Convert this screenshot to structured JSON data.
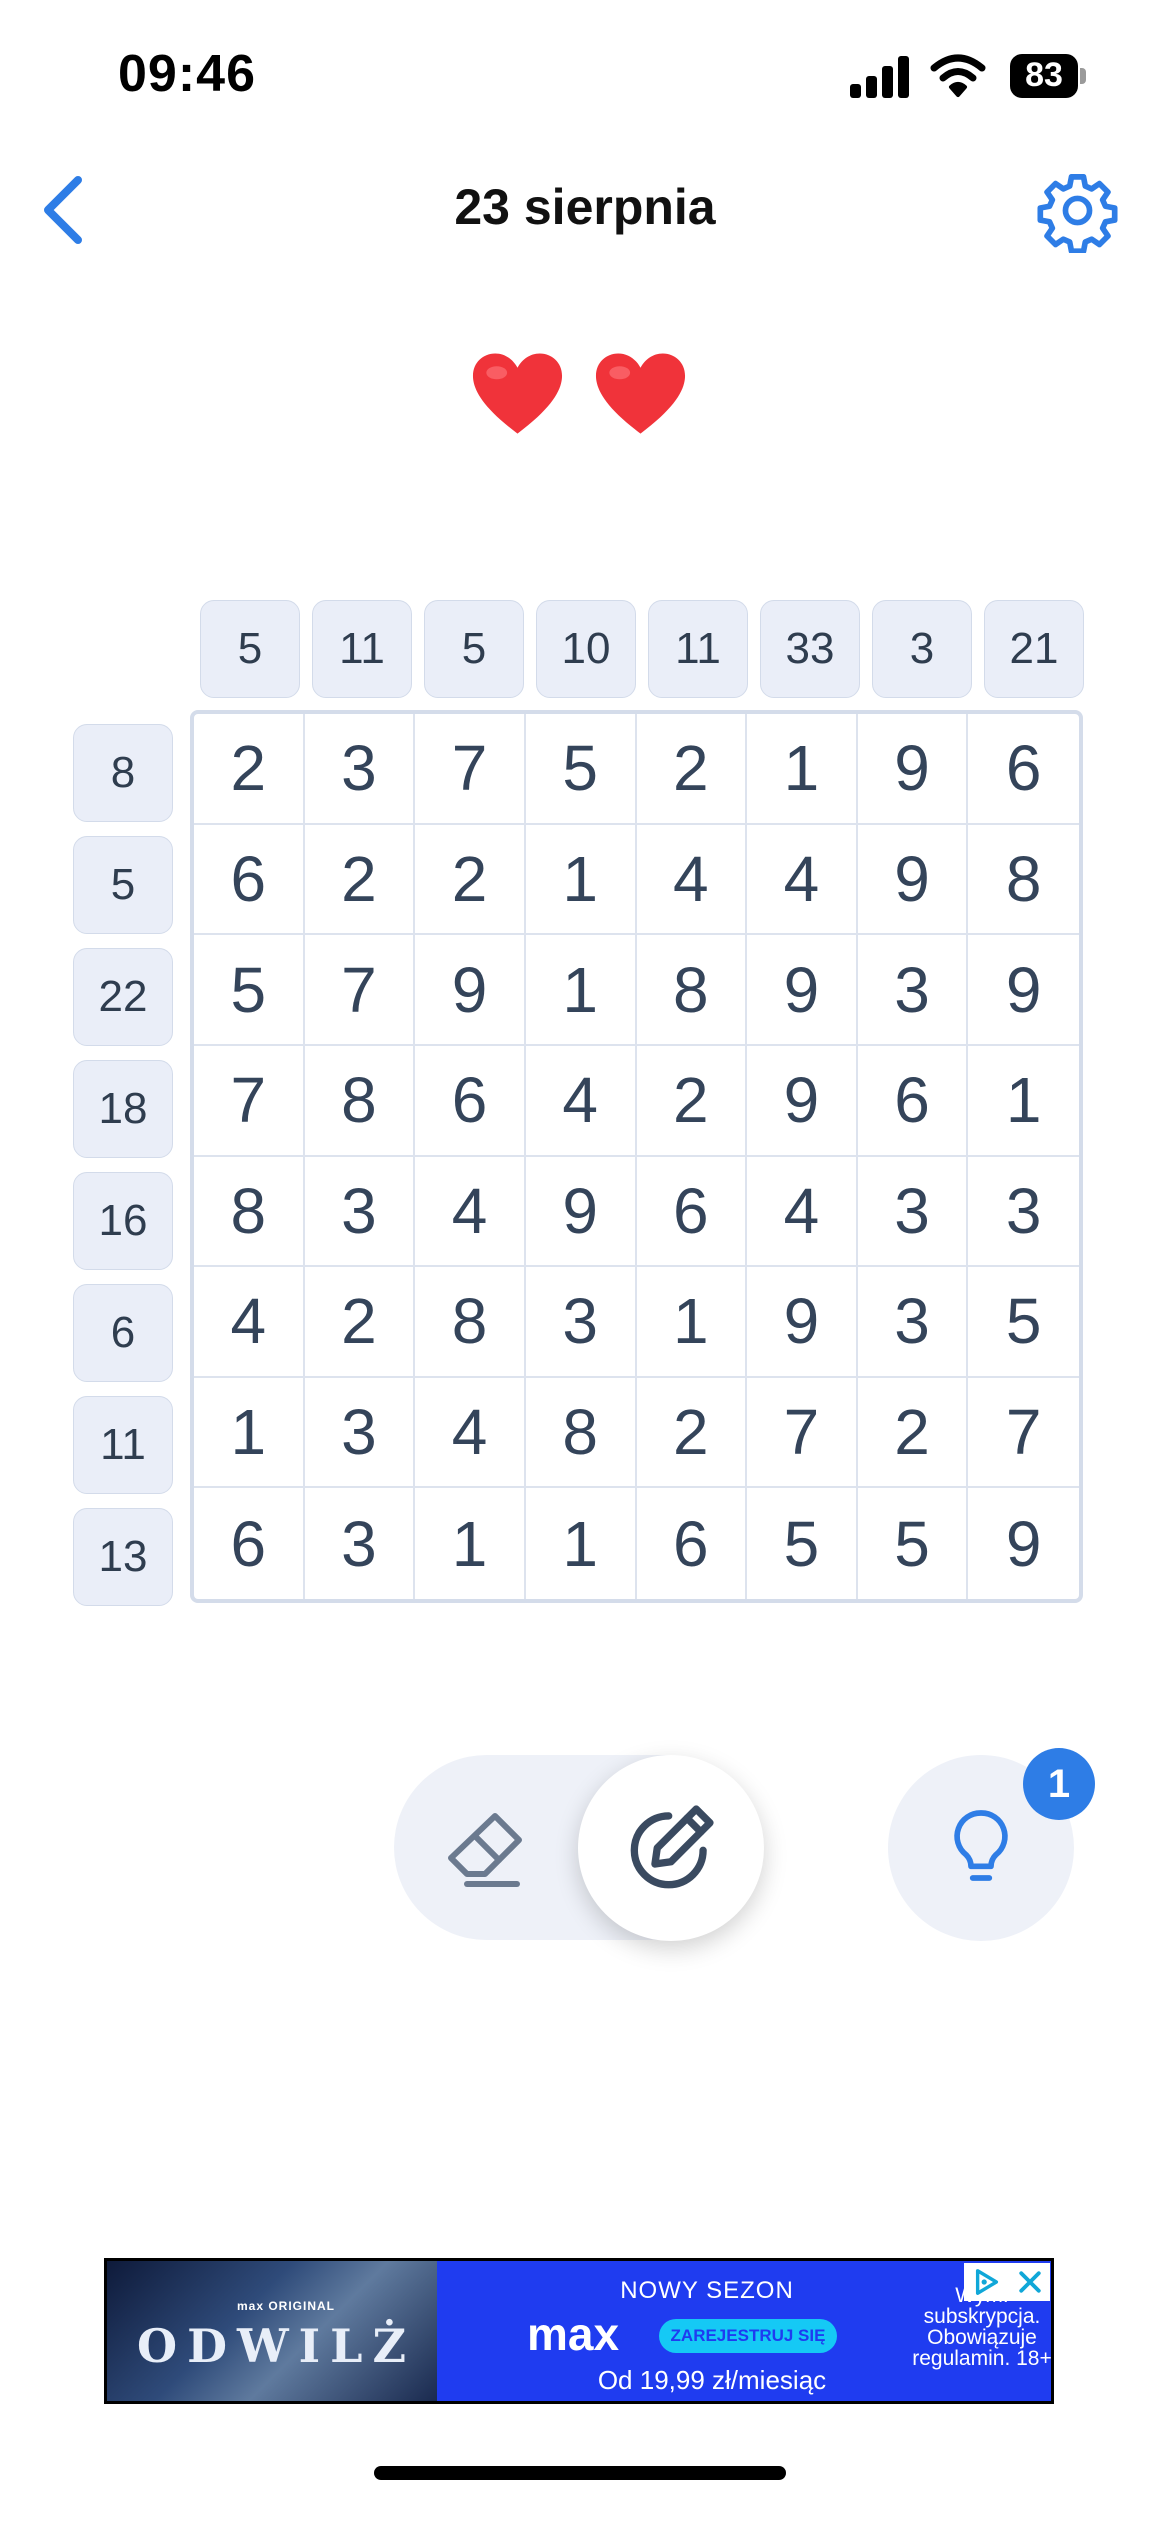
{
  "status_bar": {
    "time": "09:46",
    "battery": "83"
  },
  "header": {
    "title": "23 sierpnia",
    "back_icon": "chevron-left-icon",
    "settings_icon": "gear-icon"
  },
  "lives": {
    "count": 2,
    "icon": "heart-icon",
    "color": "#f0333a"
  },
  "puzzle": {
    "column_clues": [
      "5",
      "11",
      "5",
      "10",
      "11",
      "33",
      "3",
      "21"
    ],
    "row_clues": [
      "8",
      "5",
      "22",
      "18",
      "16",
      "6",
      "11",
      "13"
    ],
    "rows": [
      [
        "2",
        "3",
        "7",
        "5",
        "2",
        "1",
        "9",
        "6"
      ],
      [
        "6",
        "2",
        "2",
        "1",
        "4",
        "4",
        "9",
        "8"
      ],
      [
        "5",
        "7",
        "9",
        "1",
        "8",
        "9",
        "3",
        "9"
      ],
      [
        "7",
        "8",
        "6",
        "4",
        "2",
        "9",
        "6",
        "1"
      ],
      [
        "8",
        "3",
        "4",
        "9",
        "6",
        "4",
        "3",
        "3"
      ],
      [
        "4",
        "2",
        "8",
        "3",
        "1",
        "9",
        "3",
        "5"
      ],
      [
        "1",
        "3",
        "4",
        "8",
        "2",
        "7",
        "2",
        "7"
      ],
      [
        "6",
        "3",
        "1",
        "1",
        "6",
        "5",
        "5",
        "9"
      ]
    ]
  },
  "toolbar": {
    "eraser_icon": "eraser-icon",
    "pencil_icon": "pencil-icon",
    "hint_icon": "lightbulb-icon",
    "hint_badge": "1",
    "accent_color": "#2e7de6"
  },
  "ad": {
    "brand_small": "max ORIGINAL",
    "show_title": "ODWILŻ",
    "headline": "NOWY SEZON",
    "logo": "max",
    "cta": "ZAREJESTRUJ SIĘ",
    "price": "Od 19,99 zł/miesiąc",
    "disclaimer": "Wym. subskrypcja. Obowiązuje regulamin. 18+"
  }
}
